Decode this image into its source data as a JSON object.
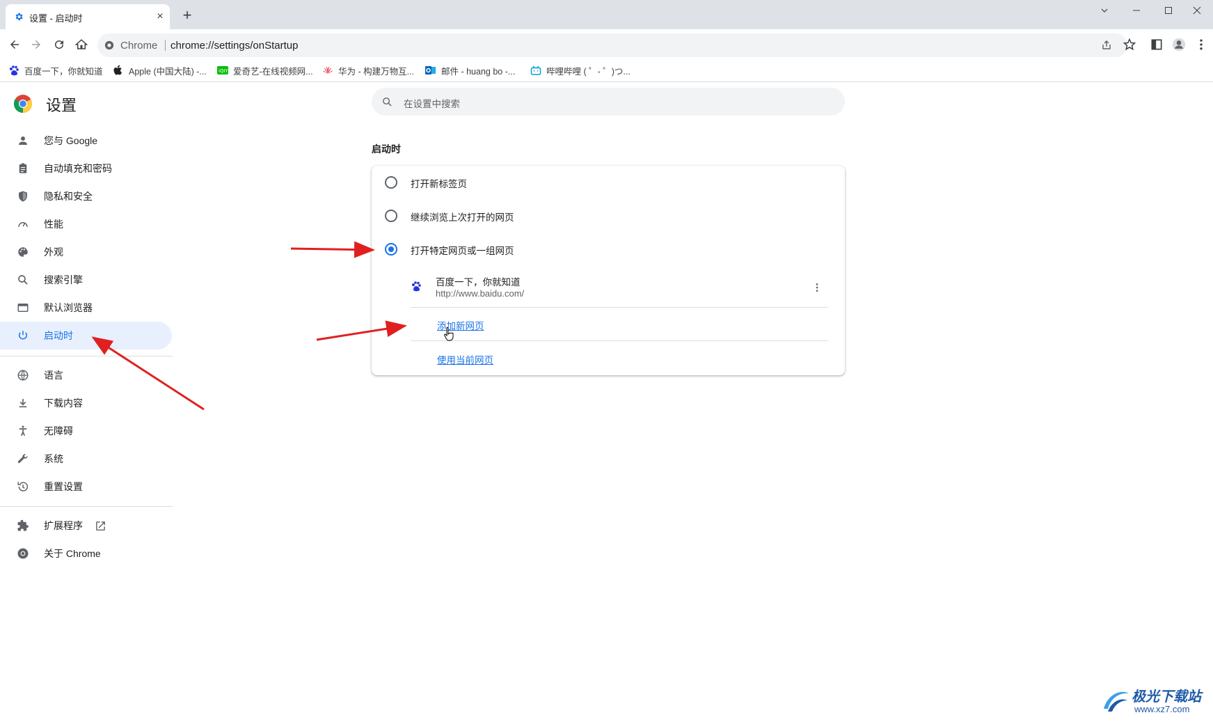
{
  "tab": {
    "title": "设置 - 启动时",
    "close": "×",
    "new_tab": "+"
  },
  "omnibox": {
    "site_label": "Chrome",
    "url": "chrome://settings/onStartup"
  },
  "bookmarks": [
    {
      "label": "百度一下，你就知道",
      "icon": "baidu-paw-icon"
    },
    {
      "label": "Apple (中国大陆) -...",
      "icon": "apple-icon"
    },
    {
      "label": "爱奇艺-在线视频网...",
      "icon": "iqiyi-icon"
    },
    {
      "label": "华为 - 构建万物互...",
      "icon": "huawei-icon"
    },
    {
      "label": "邮件 - huang bo -...",
      "icon": "outlook-icon"
    },
    {
      "label": "哔哩哔哩 ( ゜- ゜)つ...",
      "icon": "bilibili-icon"
    }
  ],
  "settings": {
    "title": "设置",
    "search_placeholder": "在设置中搜索"
  },
  "sidebar": {
    "items": [
      {
        "label": "您与 Google",
        "icon": "person-icon"
      },
      {
        "label": "自动填充和密码",
        "icon": "clipboard-icon"
      },
      {
        "label": "隐私和安全",
        "icon": "shield-icon"
      },
      {
        "label": "性能",
        "icon": "speedometer-icon"
      },
      {
        "label": "外观",
        "icon": "palette-icon"
      },
      {
        "label": "搜索引擎",
        "icon": "search-icon"
      },
      {
        "label": "默认浏览器",
        "icon": "browser-window-icon"
      },
      {
        "label": "启动时",
        "icon": "power-icon",
        "active": true
      },
      {
        "label": "语言",
        "icon": "globe-icon"
      },
      {
        "label": "下载内容",
        "icon": "download-icon"
      },
      {
        "label": "无障碍",
        "icon": "accessibility-icon"
      },
      {
        "label": "系统",
        "icon": "wrench-icon"
      },
      {
        "label": "重置设置",
        "icon": "history-icon"
      },
      {
        "label": "扩展程序",
        "icon": "puzzle-icon"
      },
      {
        "label": "关于 Chrome",
        "icon": "chrome-icon"
      }
    ]
  },
  "startup": {
    "section_title": "启动时",
    "options": [
      {
        "label": "打开新标签页",
        "checked": false
      },
      {
        "label": "继续浏览上次打开的网页",
        "checked": false
      },
      {
        "label": "打开特定网页或一组网页",
        "checked": true
      }
    ],
    "page": {
      "title": "百度一下，你就知道",
      "url": "http://www.baidu.com/"
    },
    "add_page_link": "添加新网页",
    "use_current_link": "使用当前网页"
  },
  "watermark": {
    "name": "极光下载站",
    "url": "www.xz7.com"
  },
  "colors": {
    "accent": "#1a73e8",
    "arrow": "#e02020",
    "active_bg": "#e8f0fe"
  }
}
